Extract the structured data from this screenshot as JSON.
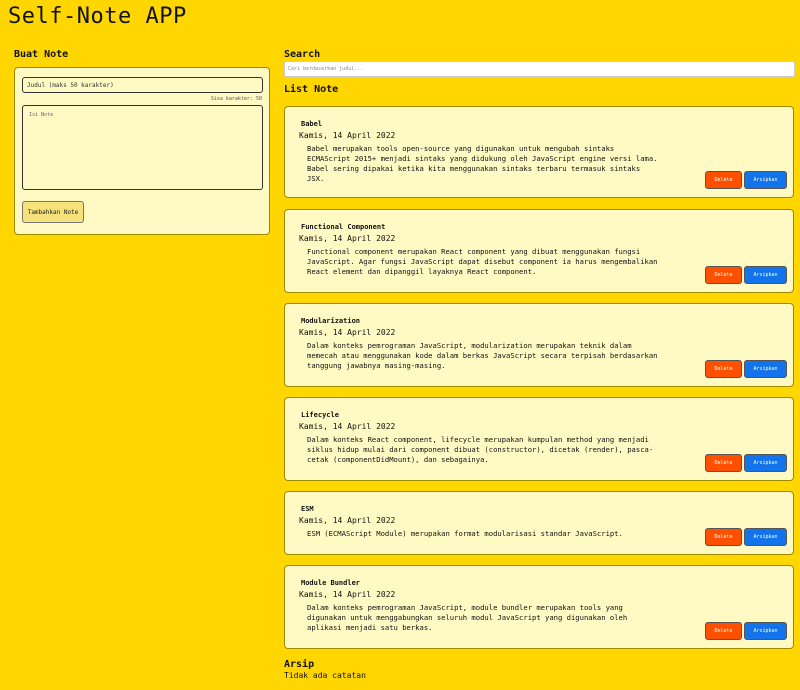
{
  "app": {
    "title": "Self-Note APP"
  },
  "form": {
    "heading": "Buat Note",
    "title_placeholder": "Judul (maks 50 karakter)",
    "char_counter": "Sisa karakter: 50",
    "body_placeholder": "Isi Note",
    "add_label": "Tambahkan Note"
  },
  "search": {
    "heading": "Search",
    "placeholder": "Cari berdasarkan judul..."
  },
  "notes": {
    "heading": "List Note",
    "delete_label": "Delete",
    "archive_label": "Arsipkan",
    "items": [
      {
        "title": "Babel",
        "date": "Kamis, 14 April 2022",
        "body": "Babel merupakan tools open-source yang digunakan untuk mengubah sintaks\nECMAScript 2015+ menjadi sintaks yang didukung oleh JavaScript engine versi lama.\nBabel sering dipakai ketika kita menggunakan sintaks terbaru termasuk sintaks\nJSX."
      },
      {
        "title": "Functional Component",
        "date": "Kamis, 14 April 2022",
        "body": "Functional component merupakan React component yang dibuat menggunakan fungsi\nJavaScript. Agar fungsi JavaScript dapat disebut component ia harus mengembalikan\nReact element dan dipanggil layaknya React component."
      },
      {
        "title": "Modularization",
        "date": "Kamis, 14 April 2022",
        "body": "Dalam konteks pemrograman JavaScript, modularization merupakan teknik dalam\nmemecah atau menggunakan kode dalam berkas JavaScript secara terpisah berdasarkan\ntanggung jawabnya masing-masing."
      },
      {
        "title": "Lifecycle",
        "date": "Kamis, 14 April 2022",
        "body": "Dalam konteks React component, lifecycle merupakan kumpulan method yang menjadi\nsiklus hidup mulai dari component dibuat (constructor), dicetak (render), pasca-\ncetak (componentDidMount), dan sebagainya."
      },
      {
        "title": "ESM",
        "date": "Kamis, 14 April 2022",
        "body": "ESM (ECMAScript Module) merupakan format modularisasi standar JavaScript."
      },
      {
        "title": "Module Bundler",
        "date": "Kamis, 14 April 2022",
        "body": "Dalam konteks pemrograman JavaScript, module bundler merupakan tools yang\ndigunakan untuk menggabungkan seluruh modul JavaScript yang digunakan oleh\naplikasi menjadi satu berkas."
      }
    ]
  },
  "archive": {
    "heading": "Arsip",
    "empty_text": "Tidak ada catatan"
  },
  "colors": {
    "background": "#ffd600",
    "card": "#fff9c4",
    "delete": "#ff5000",
    "archive": "#1273ea"
  }
}
